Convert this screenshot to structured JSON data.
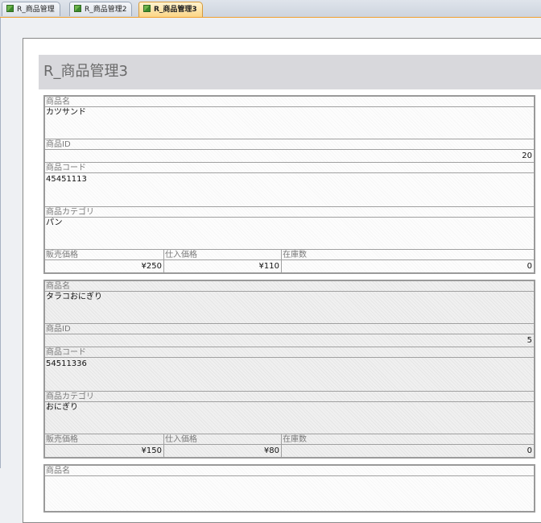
{
  "tabs": [
    {
      "label": "R_商品管理",
      "active": false
    },
    {
      "label": "R_商品管理2",
      "active": false
    },
    {
      "label": "R_商品管理3",
      "active": true
    }
  ],
  "report": {
    "title": "R_商品管理3",
    "labels": {
      "name": "商品名",
      "id": "商品ID",
      "code": "商品コード",
      "category": "商品カテゴリ",
      "sale_price": "販売価格",
      "purchase_price": "仕入価格",
      "stock": "在庫数"
    },
    "records": [
      {
        "name": "カツサンド",
        "id": "20",
        "code": "45451113",
        "category": "パン",
        "sale_price": "¥250",
        "purchase_price": "¥110",
        "stock": "0"
      },
      {
        "name": "タラコおにぎり",
        "id": "5",
        "code": "54511336",
        "category": "おにぎり",
        "sale_price": "¥150",
        "purchase_price": "¥80",
        "stock": "0"
      },
      {
        "name": "商品名"
      }
    ]
  }
}
